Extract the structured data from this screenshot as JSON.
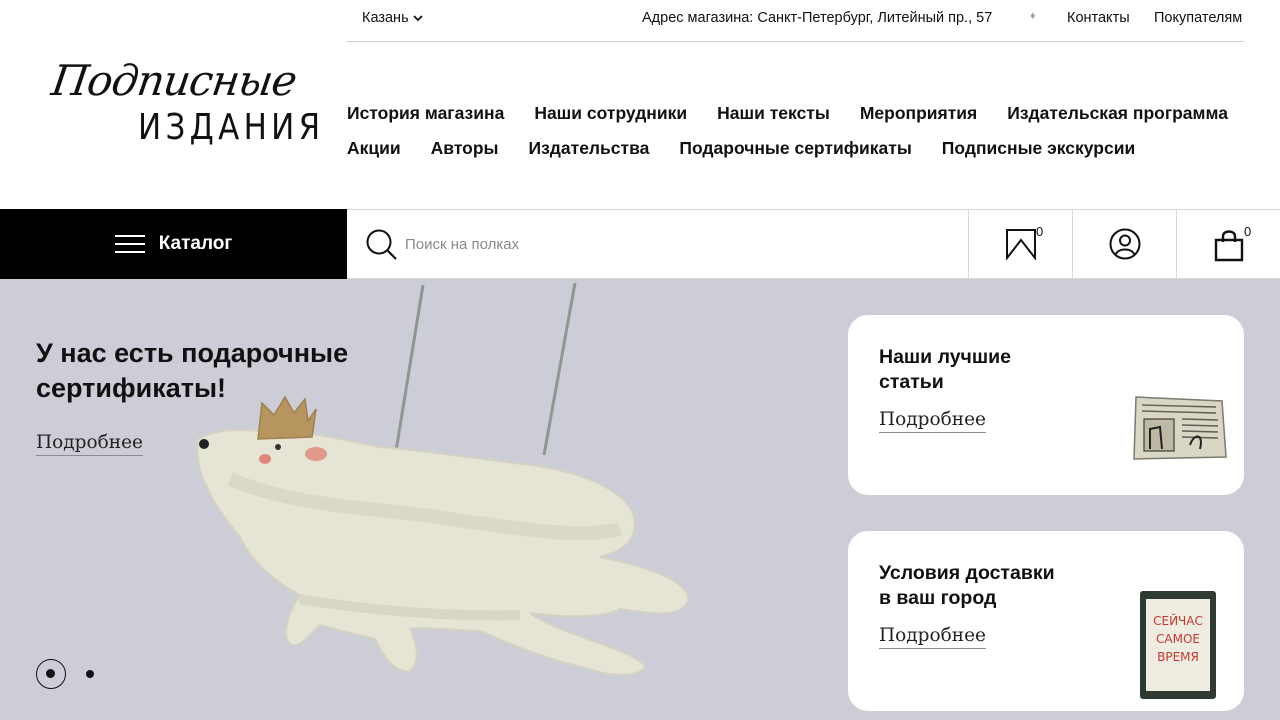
{
  "logo": {
    "script": "Подписные",
    "caps": "ИЗДАНИЯ"
  },
  "topbar": {
    "city": "Казань",
    "address": "Адрес магазина: Санкт-Петербург, Литейный пр., 57",
    "contacts": "Контакты",
    "buyers": "Покупателям"
  },
  "nav": {
    "row1": [
      "История магазина",
      "Наши сотрудники",
      "Наши тексты",
      "Мероприятия",
      "Издательская программа"
    ],
    "row2": [
      "Акции",
      "Авторы",
      "Издательства",
      "Подарочные сертификаты",
      "Подписные экскурсии"
    ]
  },
  "toolbar": {
    "catalog_label": "Каталог",
    "search_placeholder": "Поиск на полках",
    "bookmarks_count": "0",
    "cart_count": "0",
    "icons": [
      "menu-icon",
      "search-icon",
      "bookmark-icon",
      "user-icon",
      "cart-bag-icon"
    ]
  },
  "hero": {
    "title_line1": "У нас есть подарочные",
    "title_line2": "сертификаты!",
    "link": "Подробнее",
    "background": "#cdcdd8"
  },
  "cards": [
    {
      "title_line1": "Наши лучшие",
      "title_line2": "статьи",
      "link": "Подробнее"
    },
    {
      "title_line1": "Условия доставки",
      "title_line2": "в ваш город",
      "link": "Подробнее",
      "book_text": [
        "СЕЙЧАС",
        "САМОЕ",
        "ВРЕМЯ"
      ]
    }
  ]
}
